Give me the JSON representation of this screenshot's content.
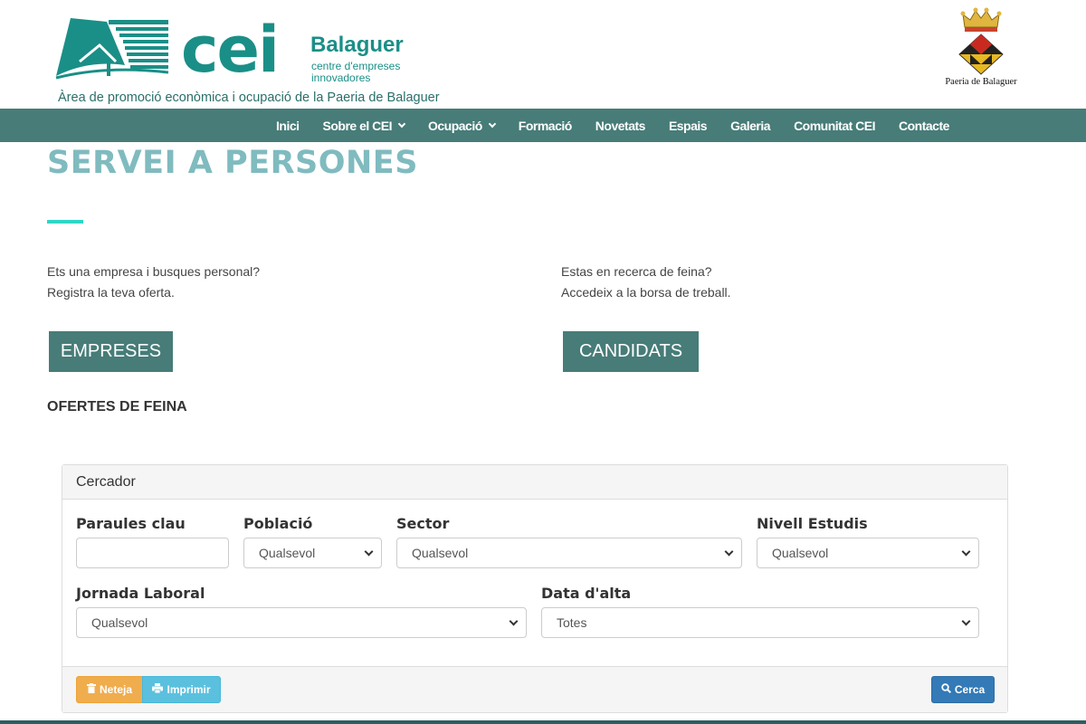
{
  "header": {
    "logo": {
      "brand": "cei",
      "city": "Balaguer",
      "subtitle_line1": "centre d'empreses",
      "subtitle_line2": "innovadores",
      "tagline": "Àrea de promoció econòmica i ocupació de la Paeria de Balaguer"
    },
    "crest_label": "Paeria de Balaguer"
  },
  "nav": {
    "items": [
      {
        "label": "Inici",
        "dropdown": false
      },
      {
        "label": "Sobre el CEI",
        "dropdown": true
      },
      {
        "label": "Ocupació",
        "dropdown": true
      },
      {
        "label": "Formació",
        "dropdown": false
      },
      {
        "label": "Novetats",
        "dropdown": false
      },
      {
        "label": "Espais",
        "dropdown": false
      },
      {
        "label": "Galeria",
        "dropdown": false
      },
      {
        "label": "Comunitat CEI",
        "dropdown": false
      },
      {
        "label": "Contacte",
        "dropdown": false
      }
    ]
  },
  "main": {
    "title": "SERVEI A PERSONES",
    "left": {
      "line1": "Ets una empresa i busques personal?",
      "line2": "Registra la teva oferta.",
      "button": "EMPRESES"
    },
    "right": {
      "line1": "Estas en recerca de feina?",
      "line2": "Accedeix a la borsa de treball.",
      "button": "CANDIDATS"
    },
    "section_heading": "OFERTES DE FEINA"
  },
  "search": {
    "panel_title": "Cercador",
    "fields": {
      "keywords": {
        "label": "Paraules clau",
        "value": "",
        "placeholder": ""
      },
      "town": {
        "label": "Població",
        "value": "Qualsevol"
      },
      "sector": {
        "label": "Sector",
        "value": "Qualsevol"
      },
      "education": {
        "label": "Nivell Estudis",
        "value": "Qualsevol"
      },
      "workday": {
        "label": "Jornada Laboral",
        "value": "Qualsevol"
      },
      "date": {
        "label": "Data d'alta",
        "value": "Totes"
      }
    },
    "buttons": {
      "clear": "Neteja",
      "print": "Imprimir",
      "search": "Cerca"
    }
  },
  "colors": {
    "brand_teal": "#1a8f87",
    "nav_bg": "#477c78",
    "title": "#7fbbbf",
    "accent": "#2fd6c4",
    "btn_warning": "#f0ad4e",
    "btn_info": "#5bc0de",
    "btn_primary": "#337ab7"
  },
  "icons": {
    "crest": "municipal-coat-of-arms-icon",
    "clear": "trash-icon",
    "print": "print-icon",
    "search": "magnifier-icon",
    "dropdown": "chevron-down-icon"
  }
}
